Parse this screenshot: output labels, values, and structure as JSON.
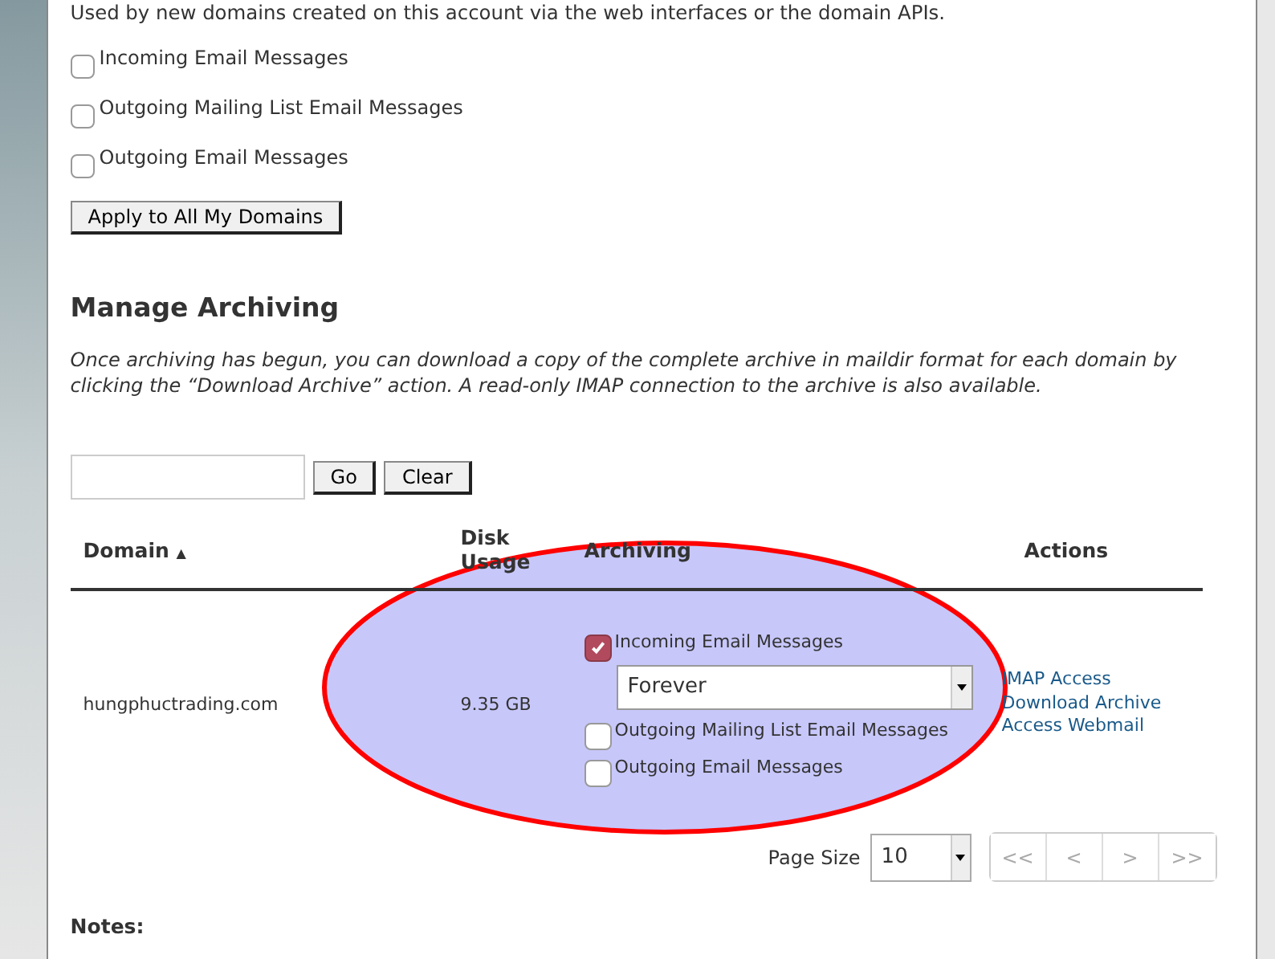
{
  "defaults": {
    "description": "Used by new domains created on this account via the web interfaces or the domain APIs.",
    "options": [
      {
        "label": "Incoming Email Messages",
        "checked": false
      },
      {
        "label": "Outgoing Mailing List Email Messages",
        "checked": false
      },
      {
        "label": "Outgoing Email Messages",
        "checked": false
      }
    ],
    "apply_button": "Apply to All My Domains"
  },
  "manage": {
    "title": "Manage Archiving",
    "description": "Once archiving has begun, you can download a copy of the complete archive in maildir format for each domain by clicking the “Download Archive” action. A read-only IMAP connection to the archive is also available.",
    "search": {
      "go_button": "Go",
      "clear_button": "Clear"
    },
    "table": {
      "columns": [
        {
          "label": "Domain",
          "sort_indicator": "▲"
        },
        {
          "label": "Disk Usage"
        },
        {
          "label": "Archiving"
        },
        {
          "label": "Actions"
        }
      ],
      "rows": [
        {
          "domain": "hungphuctrading.com",
          "disk_usage": "9.35 GB",
          "archiving": [
            {
              "label": "Incoming Email Messages",
              "checked": true,
              "retention": "Forever"
            },
            {
              "label": "Outgoing Mailing List Email Messages",
              "checked": false
            },
            {
              "label": "Outgoing Email Messages",
              "checked": false
            }
          ],
          "actions": [
            "IMAP Access",
            "Download Archive",
            "Access Webmail"
          ]
        }
      ]
    },
    "pagination": {
      "page_size_label": "Page Size",
      "page_size": "10",
      "buttons": [
        {
          "label": "<<",
          "disabled": true
        },
        {
          "label": "<",
          "disabled": true
        },
        {
          "label": ">",
          "disabled": true
        },
        {
          "label": ">>",
          "disabled": true
        }
      ]
    }
  },
  "notes": {
    "title": "Notes:"
  }
}
